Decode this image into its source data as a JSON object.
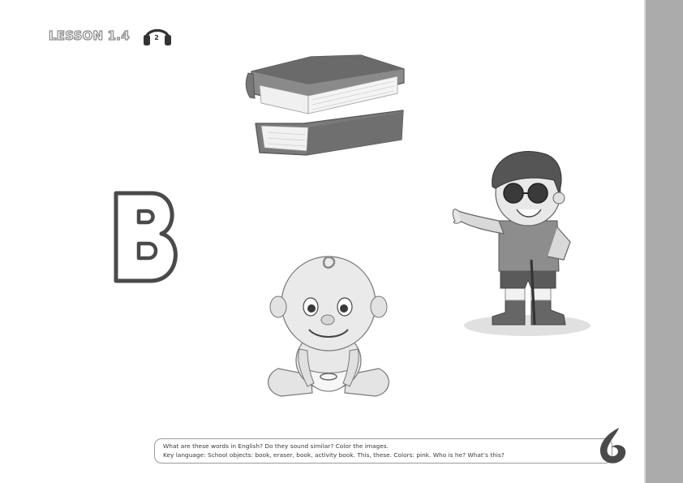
{
  "header": {
    "lesson_label": "LESSON 1.4",
    "audio_track": "2",
    "audio_icon": "headphones-icon"
  },
  "illustrations": {
    "books": "stack-of-books-illustration",
    "letter": "letter-b-illustration",
    "boy": "boy-with-sunglasses-illustration",
    "baby": "baby-illustration"
  },
  "instructions": {
    "line1": "What are these words in English?  Do they sound similar? Color the images.",
    "line2": "Key language: School objects: book, eraser, book, activity book. This, these. Colors: pink. Who is he? What’s this?"
  },
  "colors": {
    "page_background": "#ffffff",
    "side_strip": "#ababab",
    "outline": "#444444"
  }
}
